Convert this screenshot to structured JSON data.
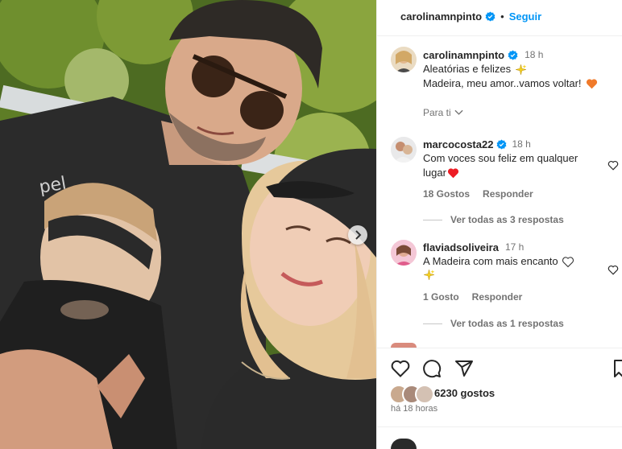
{
  "post": {
    "author": "carolinamnpinto",
    "follow_label": "Seguir",
    "caption_author": "carolinamnpinto",
    "caption_time": "18 h",
    "caption_line1": "Aleatórias e felizes",
    "caption_line2": "Madeira, meu amor..vamos voltar!",
    "translate_label": "Para ti"
  },
  "comments": [
    {
      "username": "marcocosta22",
      "verified": true,
      "time": "18 h",
      "text_line1": "Com voces sou feliz em qualquer",
      "text_line2": "lugar",
      "likes": "18 Gostos",
      "reply_label": "Responder",
      "view_replies": "Ver todas as 3 respostas"
    },
    {
      "username": "flaviadsoliveira",
      "verified": false,
      "time": "17 h",
      "text_line1": "A Madeira com mais encanto",
      "likes": "1 Gosto",
      "reply_label": "Responder",
      "view_replies": "Ver todas as 1 respostas"
    }
  ],
  "footer": {
    "likes_count": "6230 gostos",
    "posted_time": "há 18 horas"
  },
  "colors": {
    "accent": "#0095f6",
    "heart_red": "#ed1c24",
    "heart_orange": "#f07a2a",
    "sparkle": "#f7d21d"
  },
  "icons": [
    "verified-badge-icon",
    "sparkle-icon",
    "heart-icon",
    "chevron-down-icon",
    "comment-icon",
    "share-icon",
    "bookmark-icon",
    "next-arrow-icon"
  ]
}
